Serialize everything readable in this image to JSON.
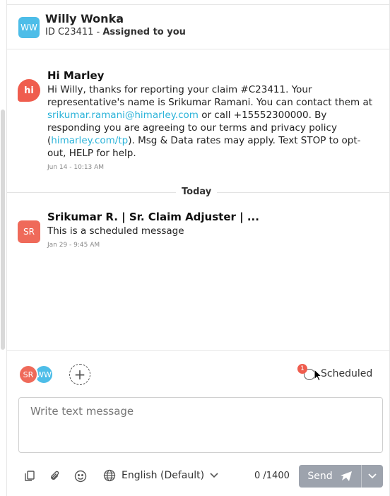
{
  "conversation": {
    "avatar_initials": "WW",
    "customer_name": "Willy Wonka",
    "id_text": "ID C23411 - ",
    "assigned_text": "Assigned to you"
  },
  "messages": [
    {
      "avatar": "hi",
      "sender": "Hi Marley",
      "body_part1": "Hi Willy, thanks for reporting your claim #C23411. Your representative's name is Srikumar Ramani. You can contact them at ",
      "email_link": "srikumar.ramani@himarley.com",
      "body_part2": " or call +15552300000. By responding you are agreeing to our terms and privacy policy (",
      "tp_link": "himarley.com/tp",
      "body_part3": "). Msg & Data rates may apply. Text STOP to opt-out, HELP for help.",
      "time": "Jun 14 - 10:13 AM"
    },
    {
      "avatar": "SR",
      "sender": "Srikumar R. | Sr. Claim Adjuster | ...",
      "body": "This is a scheduled message",
      "time": "Jan 29 - 9:45 AM"
    }
  ],
  "divider_label": "Today",
  "composer": {
    "participants": [
      "SR",
      "WW"
    ],
    "scheduled_count": "1",
    "scheduled_label": "Scheduled",
    "placeholder": "Write text message",
    "language": "English (Default)",
    "char_count": "0 /1400",
    "send_label": "Send"
  },
  "colors": {
    "accent_blue": "#4dbde8",
    "accent_red": "#ef5d4e",
    "link": "#2bb3d9",
    "send_disabled": "#9da3ad"
  }
}
